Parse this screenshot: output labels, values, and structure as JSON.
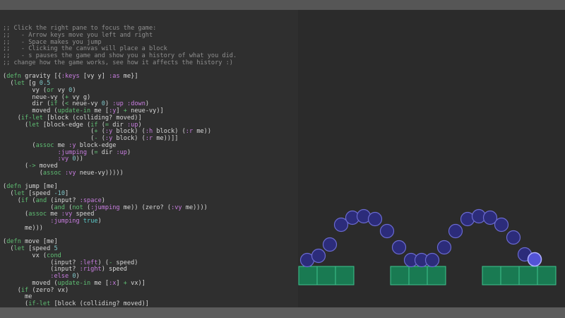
{
  "editor": {
    "lines": [
      [
        [
          ";; Click the right pane to focus the game:",
          "c"
        ]
      ],
      [
        [
          ";;   - Arrow keys move you left and right",
          "c"
        ]
      ],
      [
        [
          ";;   - Space makes you jump",
          "c"
        ]
      ],
      [
        [
          ";;   - Clicking the canvas will place a block",
          "c"
        ]
      ],
      [
        [
          ";;   - s pauses the game and show you a history of what you did.",
          "c"
        ]
      ],
      [
        [
          ";; change how the game works, see how it affects the history :)",
          "c"
        ]
      ],
      [],
      [
        [
          "(",
          ""
        ],
        [
          "defn",
          "g"
        ],
        [
          " gravity [{",
          ""
        ],
        [
          ":keys",
          "k"
        ],
        [
          " [vy y] ",
          ""
        ],
        [
          ":as",
          "k"
        ],
        [
          " me}]",
          ""
        ]
      ],
      [
        [
          "  (",
          ""
        ],
        [
          "let",
          "g"
        ],
        [
          " [g ",
          ""
        ],
        [
          "0.5",
          "n"
        ]
      ],
      [
        [
          "        vy (",
          ""
        ],
        [
          "or",
          "g"
        ],
        [
          " vy ",
          ""
        ],
        [
          "0",
          "n"
        ],
        [
          ")",
          ""
        ]
      ],
      [
        [
          "        neue-vy (",
          ""
        ],
        [
          "+",
          "g"
        ],
        [
          " vy g)",
          ""
        ]
      ],
      [
        [
          "        dir (",
          ""
        ],
        [
          "if",
          "g"
        ],
        [
          " (",
          ""
        ],
        [
          "<",
          "g"
        ],
        [
          " neue-vy ",
          ""
        ],
        [
          "0",
          "n"
        ],
        [
          ") ",
          ""
        ],
        [
          ":up",
          "k"
        ],
        [
          " ",
          ""
        ],
        [
          ":down",
          "k"
        ],
        [
          ")",
          ""
        ]
      ],
      [
        [
          "        moved (",
          ""
        ],
        [
          "update-in",
          "g"
        ],
        [
          " me [",
          ""
        ],
        [
          ":y",
          "k"
        ],
        [
          "] ",
          ""
        ],
        [
          "+",
          "g"
        ],
        [
          " neue-vy)]",
          ""
        ]
      ],
      [
        [
          "    (",
          ""
        ],
        [
          "if-let",
          "g"
        ],
        [
          " [block (colliding? moved)]",
          ""
        ]
      ],
      [
        [
          "      (",
          ""
        ],
        [
          "let",
          "g"
        ],
        [
          " [block-edge (",
          ""
        ],
        [
          "if",
          "g"
        ],
        [
          " (",
          ""
        ],
        [
          "=",
          "g"
        ],
        [
          " dir ",
          ""
        ],
        [
          ":up",
          "k"
        ],
        [
          ")",
          ""
        ]
      ],
      [
        [
          "                        (",
          ""
        ],
        [
          "+",
          "g"
        ],
        [
          " (",
          ""
        ],
        [
          ":y",
          "k"
        ],
        [
          " block) (",
          ""
        ],
        [
          ":h",
          "k"
        ],
        [
          " block) (",
          ""
        ],
        [
          ":r",
          "k"
        ],
        [
          " me))",
          ""
        ]
      ],
      [
        [
          "                        (",
          ""
        ],
        [
          "-",
          "g"
        ],
        [
          " (",
          ""
        ],
        [
          ":y",
          "k"
        ],
        [
          " block) (",
          ""
        ],
        [
          ":r",
          "k"
        ],
        [
          " me))]]",
          ""
        ]
      ],
      [
        [
          "        (",
          ""
        ],
        [
          "assoc",
          "g"
        ],
        [
          " me ",
          ""
        ],
        [
          ":y",
          "k"
        ],
        [
          " block-edge",
          ""
        ]
      ],
      [
        [
          "               ",
          ""
        ],
        [
          ":jumping",
          "k"
        ],
        [
          " (",
          ""
        ],
        [
          "=",
          "g"
        ],
        [
          " dir ",
          ""
        ],
        [
          ":up",
          "k"
        ],
        [
          ")",
          ""
        ]
      ],
      [
        [
          "               ",
          ""
        ],
        [
          ":vy",
          "k"
        ],
        [
          " ",
          ""
        ],
        [
          "0",
          "n"
        ],
        [
          "))",
          ""
        ]
      ],
      [
        [
          "      (",
          ""
        ],
        [
          "->",
          "g"
        ],
        [
          " moved",
          ""
        ]
      ],
      [
        [
          "          (",
          ""
        ],
        [
          "assoc",
          "g"
        ],
        [
          " ",
          ""
        ],
        [
          ":vy",
          "k"
        ],
        [
          " neue-vy)))))",
          ""
        ]
      ],
      [],
      [
        [
          "(",
          ""
        ],
        [
          "defn",
          "g"
        ],
        [
          " jump [me]",
          ""
        ]
      ],
      [
        [
          "  (",
          ""
        ],
        [
          "let",
          "g"
        ],
        [
          " [speed ",
          ""
        ],
        [
          "-10",
          "n"
        ],
        [
          "]",
          ""
        ]
      ],
      [
        [
          "    (",
          ""
        ],
        [
          "if",
          "g"
        ],
        [
          " (",
          ""
        ],
        [
          "and",
          "g"
        ],
        [
          " (input? ",
          ""
        ],
        [
          ":space",
          "k"
        ],
        [
          ")",
          ""
        ]
      ],
      [
        [
          "             (",
          ""
        ],
        [
          "and",
          "g"
        ],
        [
          " (",
          ""
        ],
        [
          "not",
          "g"
        ],
        [
          " (",
          ""
        ],
        [
          ":jumping",
          "k"
        ],
        [
          " me)) (zero? (",
          ""
        ],
        [
          ":vy",
          "k"
        ],
        [
          " me))))",
          ""
        ]
      ],
      [
        [
          "      (",
          ""
        ],
        [
          "assoc",
          "g"
        ],
        [
          " me ",
          ""
        ],
        [
          ":vy",
          "k"
        ],
        [
          " speed",
          ""
        ]
      ],
      [
        [
          "             ",
          ""
        ],
        [
          ":jumping",
          "k"
        ],
        [
          " ",
          ""
        ],
        [
          "true",
          "s"
        ],
        [
          ")",
          ""
        ]
      ],
      [
        [
          "      me)))",
          ""
        ]
      ],
      [],
      [
        [
          "(",
          ""
        ],
        [
          "defn",
          "g"
        ],
        [
          " move [me]",
          ""
        ]
      ],
      [
        [
          "  (",
          ""
        ],
        [
          "let",
          "g"
        ],
        [
          " [speed ",
          ""
        ],
        [
          "5",
          "n"
        ]
      ],
      [
        [
          "        vx (",
          ""
        ],
        [
          "cond",
          "g"
        ]
      ],
      [
        [
          "             (input? ",
          ""
        ],
        [
          ":left",
          "k"
        ],
        [
          ") (",
          ""
        ],
        [
          "-",
          "g"
        ],
        [
          " speed)",
          ""
        ]
      ],
      [
        [
          "             (input? ",
          ""
        ],
        [
          ":right",
          "k"
        ],
        [
          ") speed",
          ""
        ]
      ],
      [
        [
          "             ",
          ""
        ],
        [
          ":else",
          "k"
        ],
        [
          " ",
          ""
        ],
        [
          "0",
          "n"
        ],
        [
          ")",
          ""
        ]
      ],
      [
        [
          "        moved (",
          ""
        ],
        [
          "update-in",
          "g"
        ],
        [
          " me [",
          ""
        ],
        [
          ":x",
          "k"
        ],
        [
          "] ",
          ""
        ],
        [
          "+",
          "g"
        ],
        [
          " vx)]",
          ""
        ]
      ],
      [
        [
          "    (",
          ""
        ],
        [
          "if",
          "g"
        ],
        [
          " (zero? vx)",
          ""
        ]
      ],
      [
        [
          "      me",
          ""
        ]
      ],
      [
        [
          "      (",
          ""
        ],
        [
          "if-let",
          "g"
        ],
        [
          " [block (colliding? moved)]",
          ""
        ]
      ]
    ]
  },
  "game": {
    "colors": {
      "background": "#2b2b2b",
      "block_fill": "#197a52",
      "block_stroke": "#3ec48f",
      "ball_fill": "#2c2c7a",
      "ball_stroke": "#6a6ad0",
      "player_fill": "#5353d6",
      "player_stroke": "#b0b0ff"
    }
  }
}
